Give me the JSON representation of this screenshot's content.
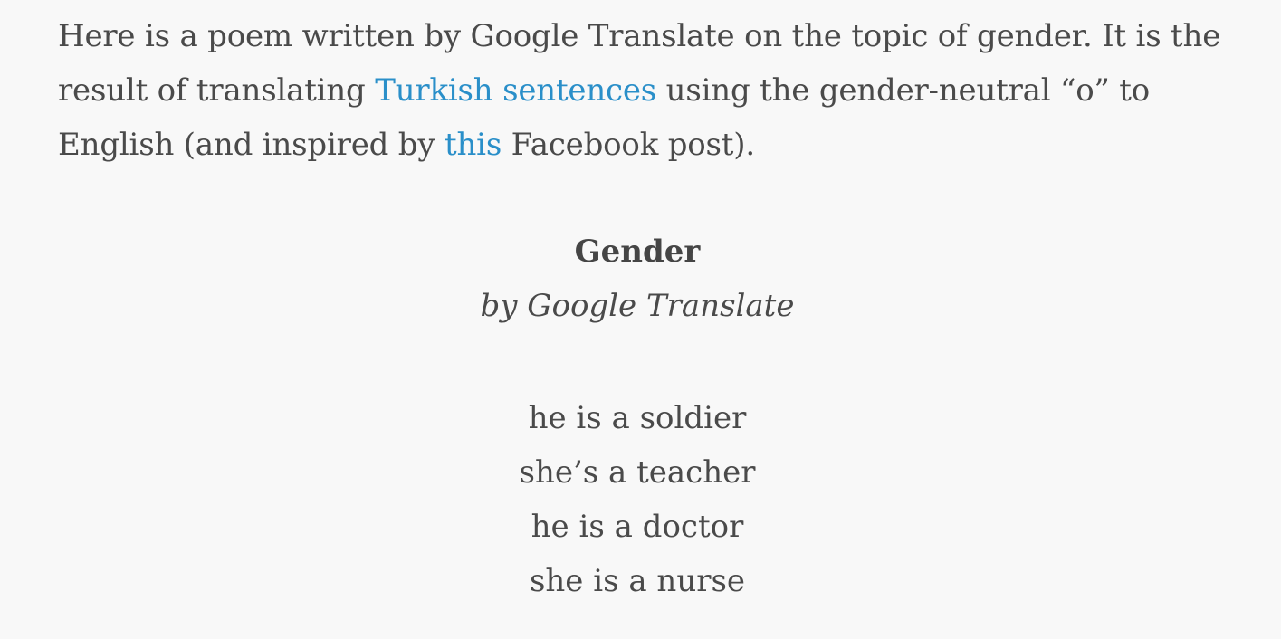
{
  "intro": {
    "part1": "Here is a poem written by Google Translate on the topic of gender. It is the result of translating ",
    "link1": "Turkish sentences",
    "part2": " using the gender-neutral “o” to English (and inspired by ",
    "link2": "this",
    "part3": " Facebook post).",
    "link_color": "#2a8fc9"
  },
  "poem": {
    "title": "Gender",
    "byline": "by Google Translate",
    "lines": [
      "he is a soldier",
      "she’s a teacher",
      "he is a doctor",
      "she is a nurse"
    ]
  }
}
